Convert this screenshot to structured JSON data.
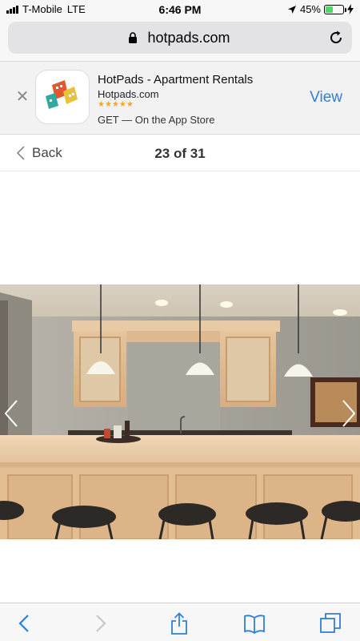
{
  "status_bar": {
    "carrier": "T-Mobile",
    "network": "LTE",
    "time": "6:46 PM",
    "battery_percent": "45%",
    "battery_level": 0.45
  },
  "browser": {
    "url": "hotpads.com"
  },
  "app_banner": {
    "app_name": "HotPads - Apartment Rentals",
    "domain": "Hotpads.com",
    "rating_stars": "★★★★★",
    "get_text": "GET — On the App Store",
    "view_label": "View"
  },
  "gallery": {
    "back_label": "Back",
    "counter": "23 of 31"
  },
  "icons": {
    "close": "close-icon",
    "lock": "lock-icon",
    "reload": "reload-icon",
    "back": "chevron-left-icon",
    "prev": "arrow-left-icon",
    "next": "arrow-right-icon",
    "share": "share-icon",
    "bookmarks": "bookmarks-icon",
    "tabs": "tabs-icon"
  },
  "colors": {
    "accent": "#2f7fd8",
    "star": "#f5a623",
    "battery": "#4cd964"
  }
}
